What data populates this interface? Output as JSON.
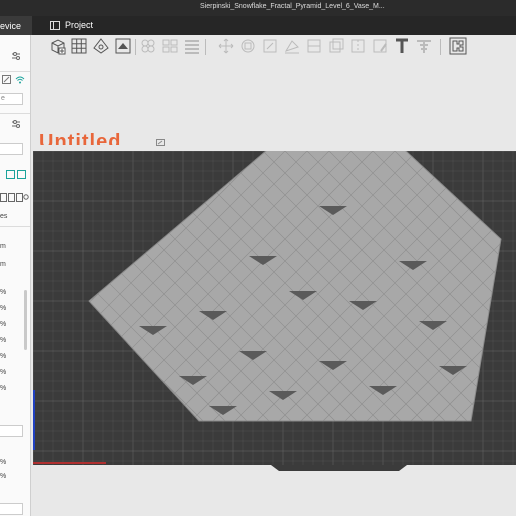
{
  "window": {
    "title": "Sierpinski_Snowflake_Fractal_Pyramid_Level_6_Vase_M..."
  },
  "tabs": {
    "device_label": "evice",
    "project_label": "Project"
  },
  "sidebar": {
    "unit_labels": [
      "m",
      "m",
      "%",
      "%",
      "%",
      "%",
      "%",
      "%",
      "%",
      "%",
      "%"
    ],
    "section_label": "es",
    "field_text": "e"
  },
  "plate": {
    "name": "Untitled"
  },
  "icons": {
    "toolbar": [
      "add-cube-icon",
      "grid-arrange-icon",
      "orient-icon",
      "plate-settings-icon",
      "split-objects-icon",
      "split-parts-icon",
      "layers-icon",
      "move-icon",
      "rotate-icon",
      "scale-icon",
      "lay-on-face-icon",
      "cut-icon",
      "support-paint-icon",
      "seam-paint-icon",
      "color-paint-icon",
      "text-icon",
      "measure-icon",
      "assembly-icon"
    ]
  },
  "colors": {
    "accent": "#e8663a",
    "teal": "#1aa39b",
    "plate": "#3b3b3b",
    "model": "#a8a8a8"
  }
}
